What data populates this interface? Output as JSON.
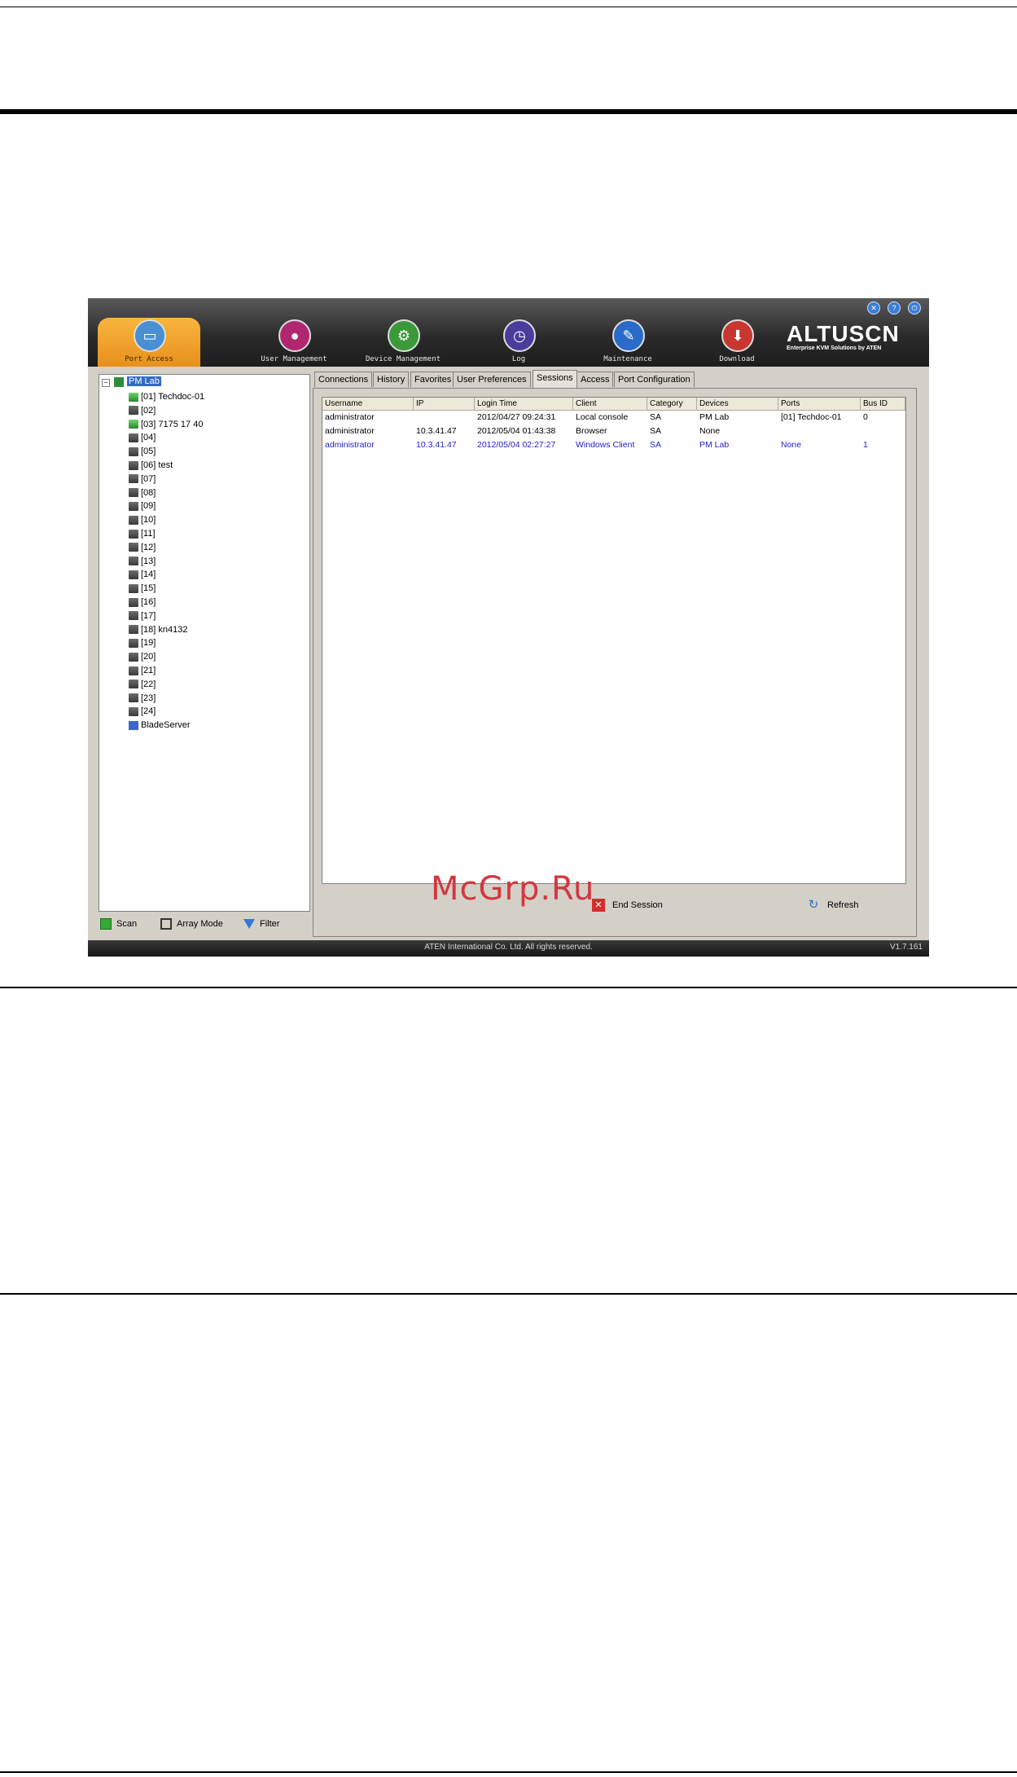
{
  "brand": {
    "name": "ALTUSCN",
    "tagline": "Enterprise KVM Solutions by ATEN"
  },
  "topbar": {
    "nav": [
      {
        "label": "Port Access",
        "icon": "monitor-icon"
      },
      {
        "label": "User Management",
        "icon": "users-icon"
      },
      {
        "label": "Device Management",
        "icon": "device-settings-icon"
      },
      {
        "label": "Log",
        "icon": "log-clock-icon"
      },
      {
        "label": "Maintenance",
        "icon": "maintenance-icon"
      },
      {
        "label": "Download",
        "icon": "download-icon"
      }
    ],
    "controls": [
      "close-icon",
      "help-icon",
      "logout-icon"
    ]
  },
  "tree": {
    "root": "PM Lab",
    "items": [
      "[01] Techdoc-01",
      "[02]",
      "[03] 7175 17 40",
      "[04]",
      "[05]",
      "[06] test",
      "[07]",
      "[08]",
      "[09]",
      "[10]",
      "[11]",
      "[12]",
      "[13]",
      "[14]",
      "[15]",
      "[16]",
      "[17]",
      "[18] kn4132",
      "[19]",
      "[20]",
      "[21]",
      "[22]",
      "[23]",
      "[24]",
      "BladeServer"
    ]
  },
  "left_toolbar": {
    "scan": "Scan",
    "array_mode": "Array Mode",
    "filter": "Filter"
  },
  "tabs": [
    "Connections",
    "History",
    "Favorites",
    "User Preferences",
    "Sessions",
    "Access",
    "Port Configuration"
  ],
  "sessions": {
    "columns": [
      "Username",
      "IP",
      "Login Time",
      "Client",
      "Category",
      "Devices",
      "Ports",
      "Bus ID"
    ],
    "rows": [
      [
        "administrator",
        "",
        "2012/04/27 09:24:31",
        "Local console",
        "SA",
        "PM Lab",
        "[01] Techdoc-01",
        "0"
      ],
      [
        "administrator",
        "10.3.41.47",
        "2012/05/04 01:43:38",
        "Browser",
        "SA",
        "None",
        "",
        ""
      ],
      [
        "administrator",
        "10.3.41.47",
        "2012/05/04 02:27:27",
        "Windows Client",
        "SA",
        "PM Lab",
        "None",
        "1"
      ]
    ]
  },
  "actions": {
    "end_session": "End Session",
    "refresh": "Refresh"
  },
  "status": {
    "copyright": "ATEN International Co. Ltd. All rights reserved.",
    "version": "V1.7.161"
  },
  "watermark": "McGrp.Ru"
}
